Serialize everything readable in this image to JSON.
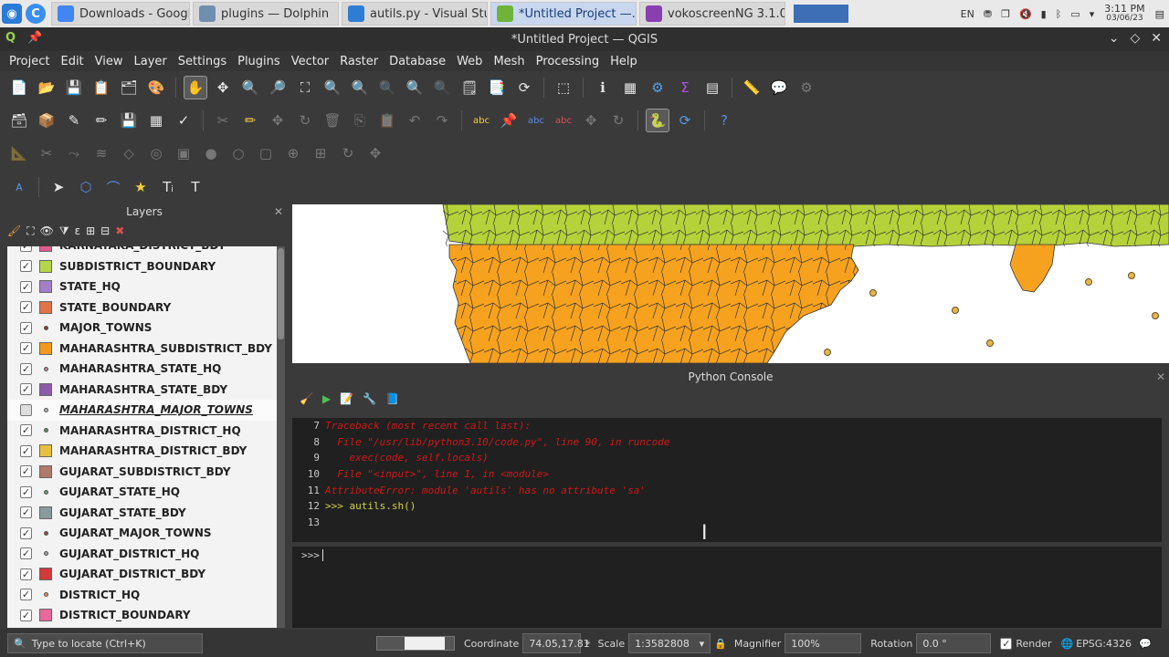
{
  "taskbar": {
    "tasks": [
      {
        "label": "Downloads - Google ...",
        "color": "#4285f4"
      },
      {
        "label": "plugins — Dolphin",
        "color": "#6f8fb0"
      },
      {
        "label": "autils.py - Visual Stud...",
        "color": "#2d7dd2"
      },
      {
        "label": "*Untitled Project —...",
        "color": "#6fb33a"
      },
      {
        "label": "vokoscreenNG 3.1.0",
        "color": "#8a3fb0"
      }
    ],
    "lang": "EN",
    "time": "3:11 PM",
    "date": "03/06/23"
  },
  "window": {
    "title": "*Untitled Project — QGIS"
  },
  "menu": [
    "Project",
    "Edit",
    "View",
    "Layer",
    "Settings",
    "Plugins",
    "Vector",
    "Raster",
    "Database",
    "Web",
    "Mesh",
    "Processing",
    "Help"
  ],
  "layers_panel": {
    "title": "Layers",
    "layers": [
      {
        "name": "KARNATAKA_DISTRICT_BDY",
        "checked": true,
        "kind": "fill",
        "color": "#e05c8c"
      },
      {
        "name": "SUBDISTRICT_BOUNDARY",
        "checked": true,
        "kind": "fill",
        "color": "#b8d44a"
      },
      {
        "name": "STATE_HQ",
        "checked": true,
        "kind": "fill",
        "color": "#a27fc8"
      },
      {
        "name": "STATE_BOUNDARY",
        "checked": true,
        "kind": "fill",
        "color": "#e0744a"
      },
      {
        "name": "MAJOR_TOWNS",
        "checked": true,
        "kind": "point",
        "color": "#8a3a3a"
      },
      {
        "name": "MAHARASHTRA_SUBDISTRICT_BDY",
        "checked": true,
        "kind": "fill",
        "color": "#f39a1c"
      },
      {
        "name": "MAHARASHTRA_STATE_HQ",
        "checked": true,
        "kind": "point",
        "color": "#c87a9a"
      },
      {
        "name": "MAHARASHTRA_STATE_BDY",
        "checked": true,
        "kind": "fill",
        "color": "#8c5aa8"
      },
      {
        "name": "MAHARASHTRA_MAJOR_TOWNS",
        "checked": false,
        "kind": "point",
        "color": "#b0b0b0"
      },
      {
        "name": "MAHARASHTRA_DISTRICT_HQ",
        "checked": true,
        "kind": "point",
        "color": "#5a8a5a"
      },
      {
        "name": "MAHARASHTRA_DISTRICT_BDY",
        "checked": true,
        "kind": "fill",
        "color": "#e8c040"
      },
      {
        "name": "GUJARAT_SUBDISTRICT_BDY",
        "checked": true,
        "kind": "fill",
        "color": "#b07a6a"
      },
      {
        "name": "GUJARAT_STATE_HQ",
        "checked": true,
        "kind": "point",
        "color": "#6a9a6a"
      },
      {
        "name": "GUJARAT_STATE_BDY",
        "checked": true,
        "kind": "fill",
        "color": "#8a9a9a"
      },
      {
        "name": "GUJARAT_MAJOR_TOWNS",
        "checked": true,
        "kind": "point",
        "color": "#8a4a4a"
      },
      {
        "name": "GUJARAT_DISTRICT_HQ",
        "checked": true,
        "kind": "point",
        "color": "#9aa0a0"
      },
      {
        "name": "GUJARAT_DISTRICT_BDY",
        "checked": true,
        "kind": "fill",
        "color": "#d03a3a"
      },
      {
        "name": "DISTRICT_HQ",
        "checked": true,
        "kind": "point",
        "color": "#e09040"
      },
      {
        "name": "DISTRICT_BOUNDARY",
        "checked": true,
        "kind": "fill",
        "color": "#e8689a"
      }
    ]
  },
  "python_console": {
    "title": "Python Console",
    "lines": [
      {
        "n": "7",
        "text": "Traceback (most recent call last):",
        "kind": "error"
      },
      {
        "n": "8",
        "text": "  File \"/usr/lib/python3.10/code.py\", line 90, in runcode",
        "kind": "error"
      },
      {
        "n": "9",
        "text": "    exec(code, self.locals)",
        "kind": "error"
      },
      {
        "n": "10",
        "text": "  File \"<input>\", line 1, in <module>",
        "kind": "error"
      },
      {
        "n": "11",
        "text": "AttributeError: module 'autils' has no attribute 'sa'",
        "kind": "error"
      },
      {
        "n": "12",
        "text": ">>> autils.sh()",
        "kind": "prompt"
      },
      {
        "n": "13",
        "text": "",
        "kind": "prompt"
      }
    ],
    "input_prompt": ">>>"
  },
  "statusbar": {
    "locate_placeholder": "Type to locate (Ctrl+K)",
    "coordinate_label": "Coordinate",
    "coordinate_value": "74.05,17.81",
    "scale_label": "Scale",
    "scale_value": "1:3582808",
    "magnifier_label": "Magnifier",
    "magnifier_value": "100%",
    "rotation_label": "Rotation",
    "rotation_value": "0.0 °",
    "render_label": "Render",
    "crs": "EPSG:4326"
  },
  "map_colors": {
    "north": "#b5d23a",
    "maharashtra": "#f7a21f",
    "points": "#e2b84d"
  }
}
